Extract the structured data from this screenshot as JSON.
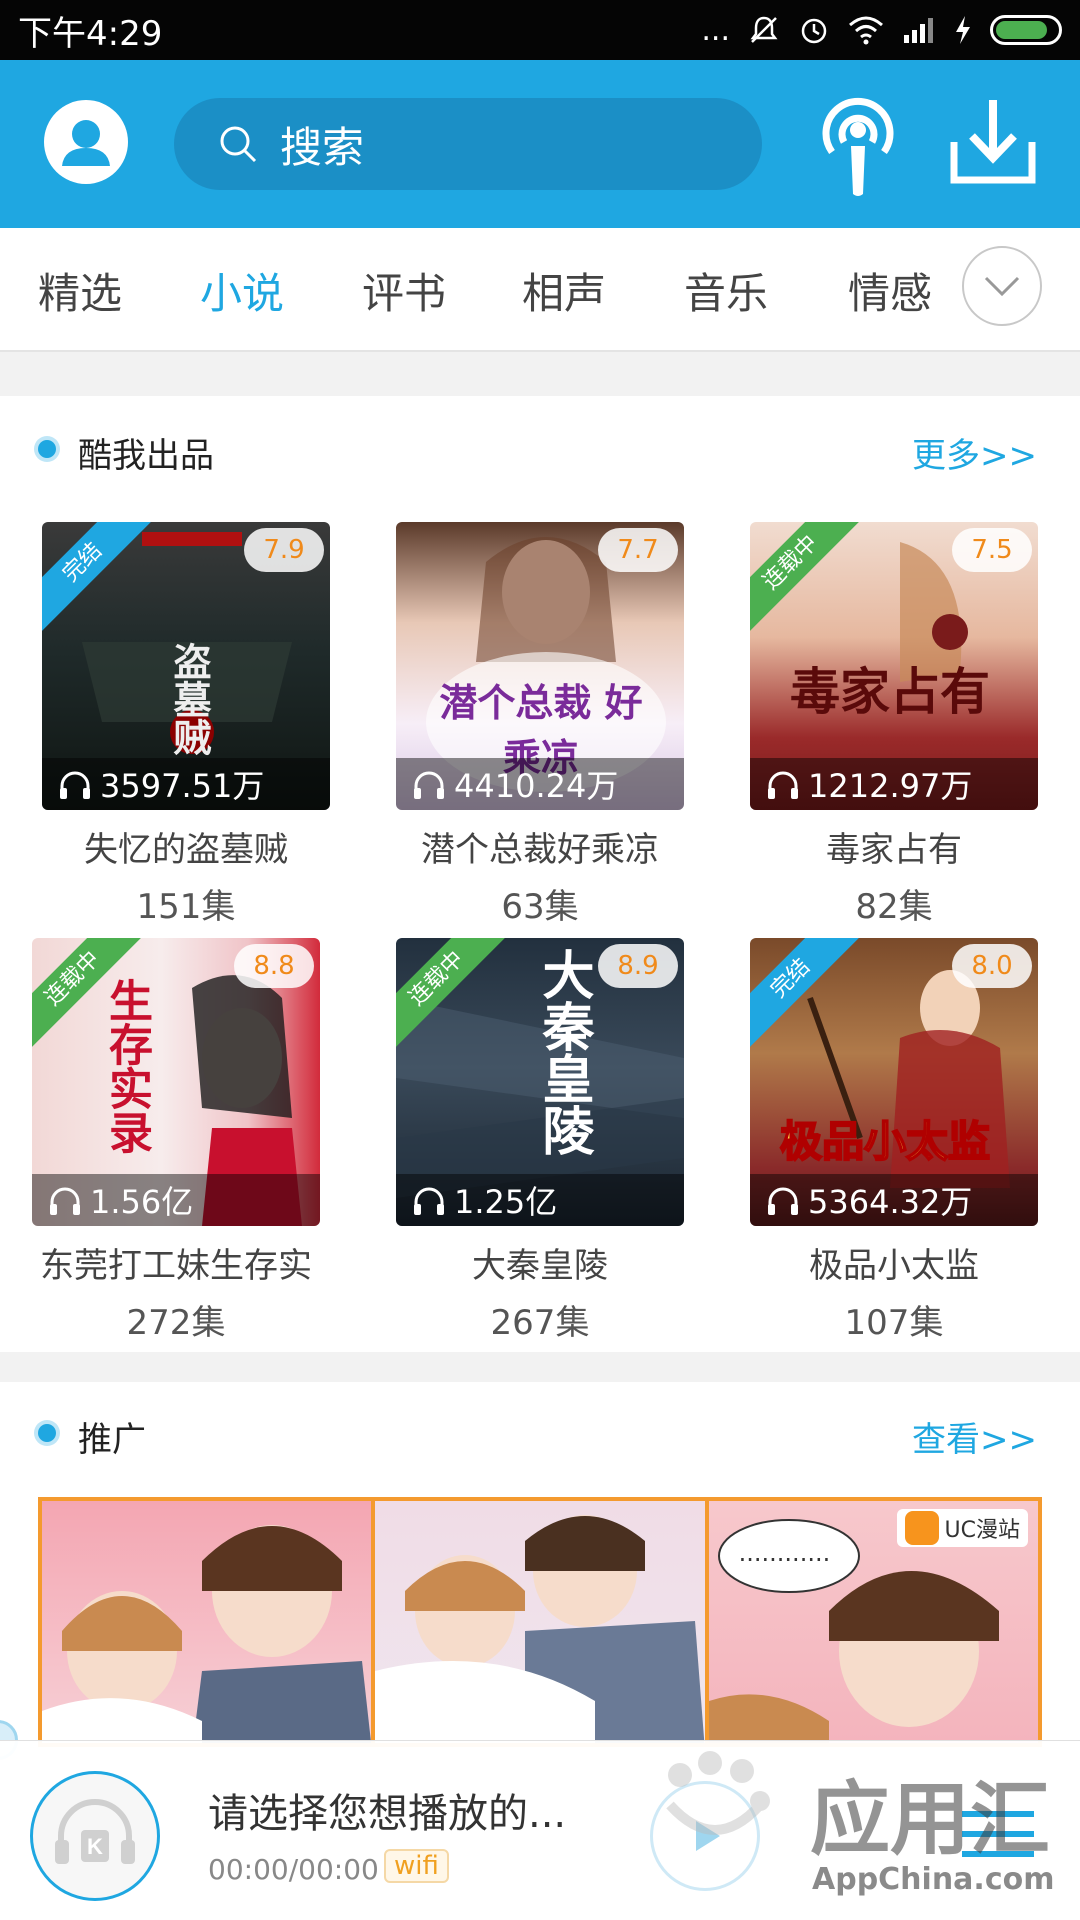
{
  "status_bar": {
    "time": "下午4:29",
    "dots": "..."
  },
  "header": {
    "search_placeholder": "搜索"
  },
  "tabs": [
    {
      "label": "精选",
      "active": false
    },
    {
      "label": "小说",
      "active": true
    },
    {
      "label": "评书",
      "active": false
    },
    {
      "label": "相声",
      "active": false
    },
    {
      "label": "音乐",
      "active": false
    },
    {
      "label": "情感",
      "active": false
    }
  ],
  "section_kuwo": {
    "title": "酷我出品",
    "more": "更多>>",
    "books": [
      {
        "title": "失忆的盗墓贼",
        "episodes": "151集",
        "score": "7.9",
        "plays": "3597.51万",
        "badge": "完结",
        "badge_color": "blue",
        "cover_text": "盗墓贼"
      },
      {
        "title": "潜个总裁好乘凉",
        "episodes": "63集",
        "score": "7.7",
        "plays": "4410.24万",
        "badge": "",
        "badge_color": "",
        "cover_text": "潜个总裁 好乘凉"
      },
      {
        "title": "毒家占有",
        "episodes": "82集",
        "score": "7.5",
        "plays": "1212.97万",
        "badge": "连载中",
        "badge_color": "green",
        "cover_text": "毒家占有"
      },
      {
        "title": "东莞打工妹生存实",
        "episodes": "272集",
        "score": "8.8",
        "plays": "1.56亿",
        "badge": "连载中",
        "badge_color": "green",
        "cover_text": "生存实录"
      },
      {
        "title": "大秦皇陵",
        "episodes": "267集",
        "score": "8.9",
        "plays": "1.25亿",
        "badge": "连载中",
        "badge_color": "green",
        "cover_text": "大秦皇陵"
      },
      {
        "title": "极品小太监",
        "episodes": "107集",
        "score": "8.0",
        "plays": "5364.32万",
        "badge": "完结",
        "badge_color": "blue",
        "cover_text": "极品小太监"
      }
    ]
  },
  "section_promo": {
    "title": "推广",
    "more": "查看>>",
    "uc_label": "UC漫站",
    "bubble_text": "............"
  },
  "player": {
    "title": "请选择您想播放的...",
    "time": "00:00/00:00",
    "network": "wifi"
  },
  "watermark": {
    "text": "应用汇",
    "sub": "AppChina.com"
  },
  "colors": {
    "brand": "#1fa7e1",
    "score": "#f08a1a",
    "badge_green": "#4caf50",
    "promo_border": "#f49a2e"
  }
}
